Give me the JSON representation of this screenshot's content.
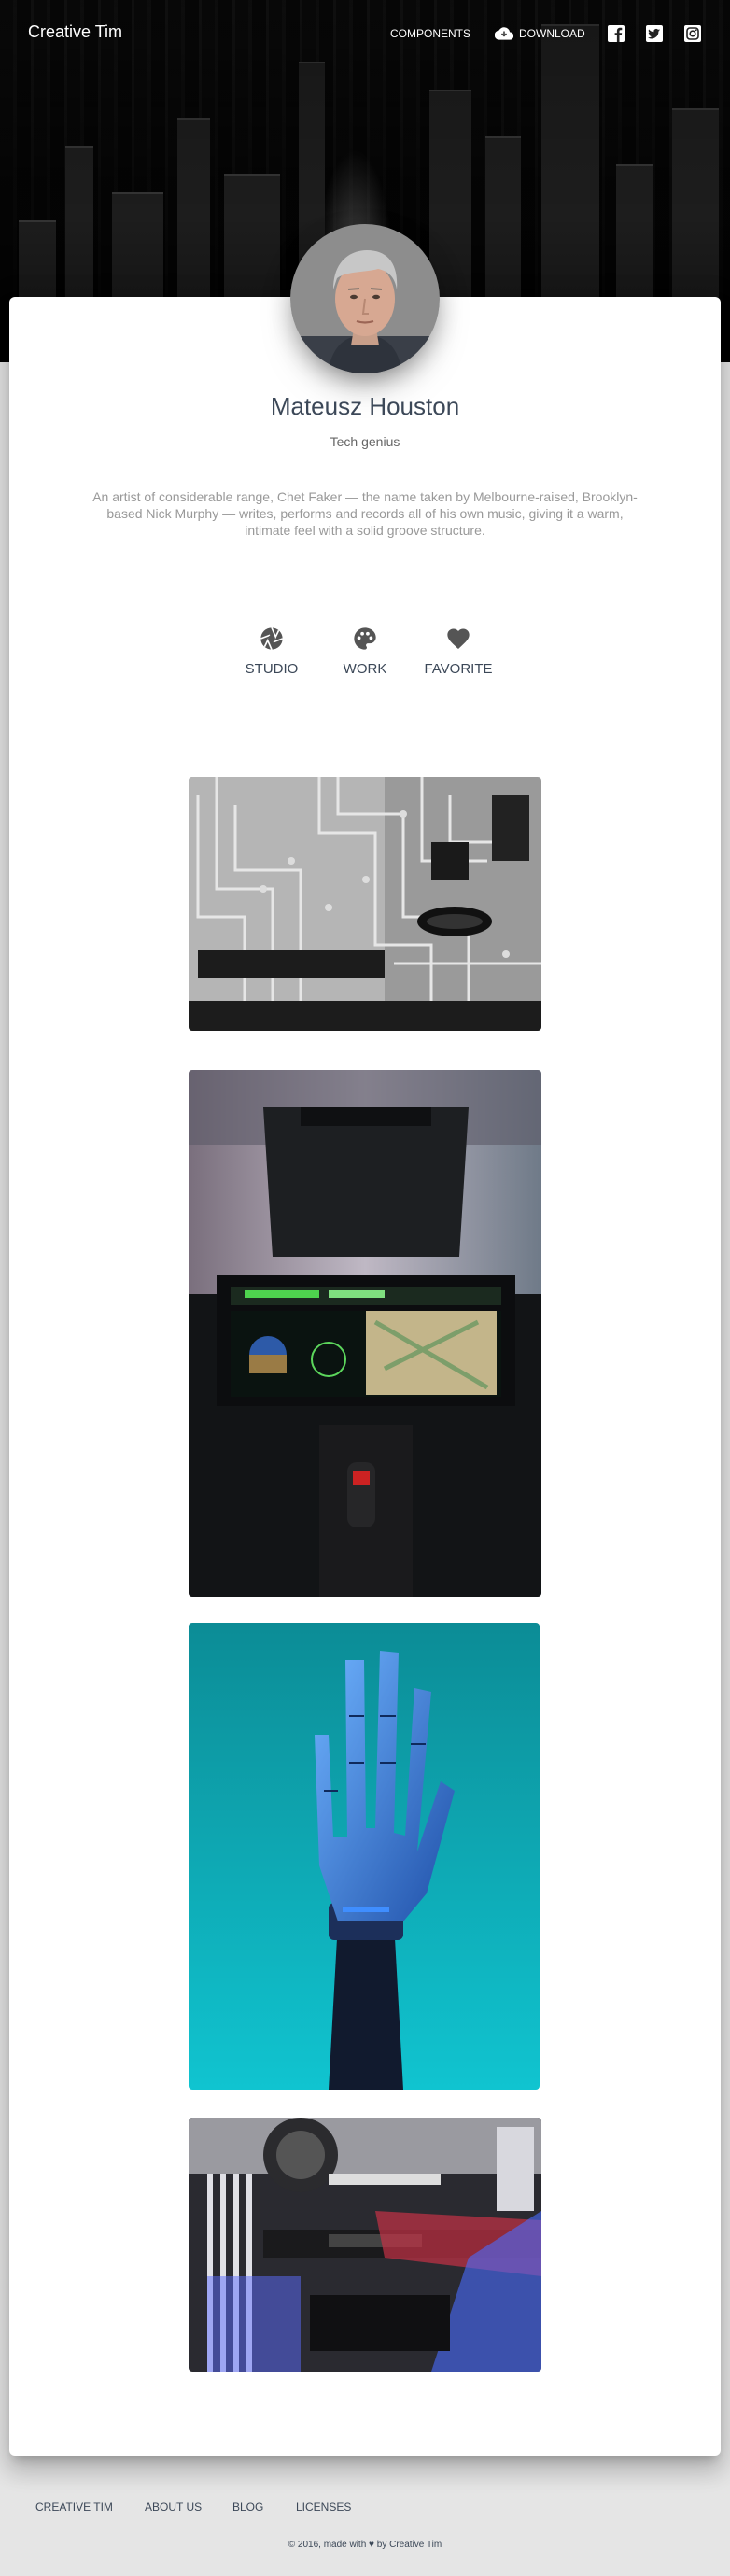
{
  "navbar": {
    "brand": "Creative Tim",
    "links": [
      {
        "label": "COMPONENTS",
        "icon": "apps-icon"
      },
      {
        "label": "DOWNLOAD",
        "icon": "cloud-download-icon"
      }
    ],
    "social_icons": [
      "facebook-icon",
      "twitter-icon",
      "instagram-icon"
    ]
  },
  "profile": {
    "name": "Mateusz Houston",
    "role": "Tech genius",
    "bio": "An artist of considerable range, Chet Faker — the name taken by Melbourne-raised, Brooklyn-based Nick Murphy — writes, performs and records all of his own music, giving it a warm, intimate feel with a solid groove structure."
  },
  "tabs": [
    {
      "label": "STUDIO",
      "icon": "camera-shutter-icon"
    },
    {
      "label": "WORK",
      "icon": "palette-icon"
    },
    {
      "label": "FAVORITE",
      "icon": "heart-icon"
    }
  ],
  "gallery": [
    {
      "name": "circuit-board-photo"
    },
    {
      "name": "cockpit-photo"
    },
    {
      "name": "robot-hand-photo"
    },
    {
      "name": "computer-hardware-photo"
    }
  ],
  "footer": {
    "links": [
      "CREATIVE TIM",
      "ABOUT US",
      "BLOG",
      "LICENSES"
    ],
    "copyright": "© 2016, made with ♥ by Creative Tim"
  },
  "colors": {
    "page_background": "#e5e5e5",
    "card_background": "#ffffff",
    "text_primary": "#3c4858",
    "text_muted": "#999999"
  }
}
